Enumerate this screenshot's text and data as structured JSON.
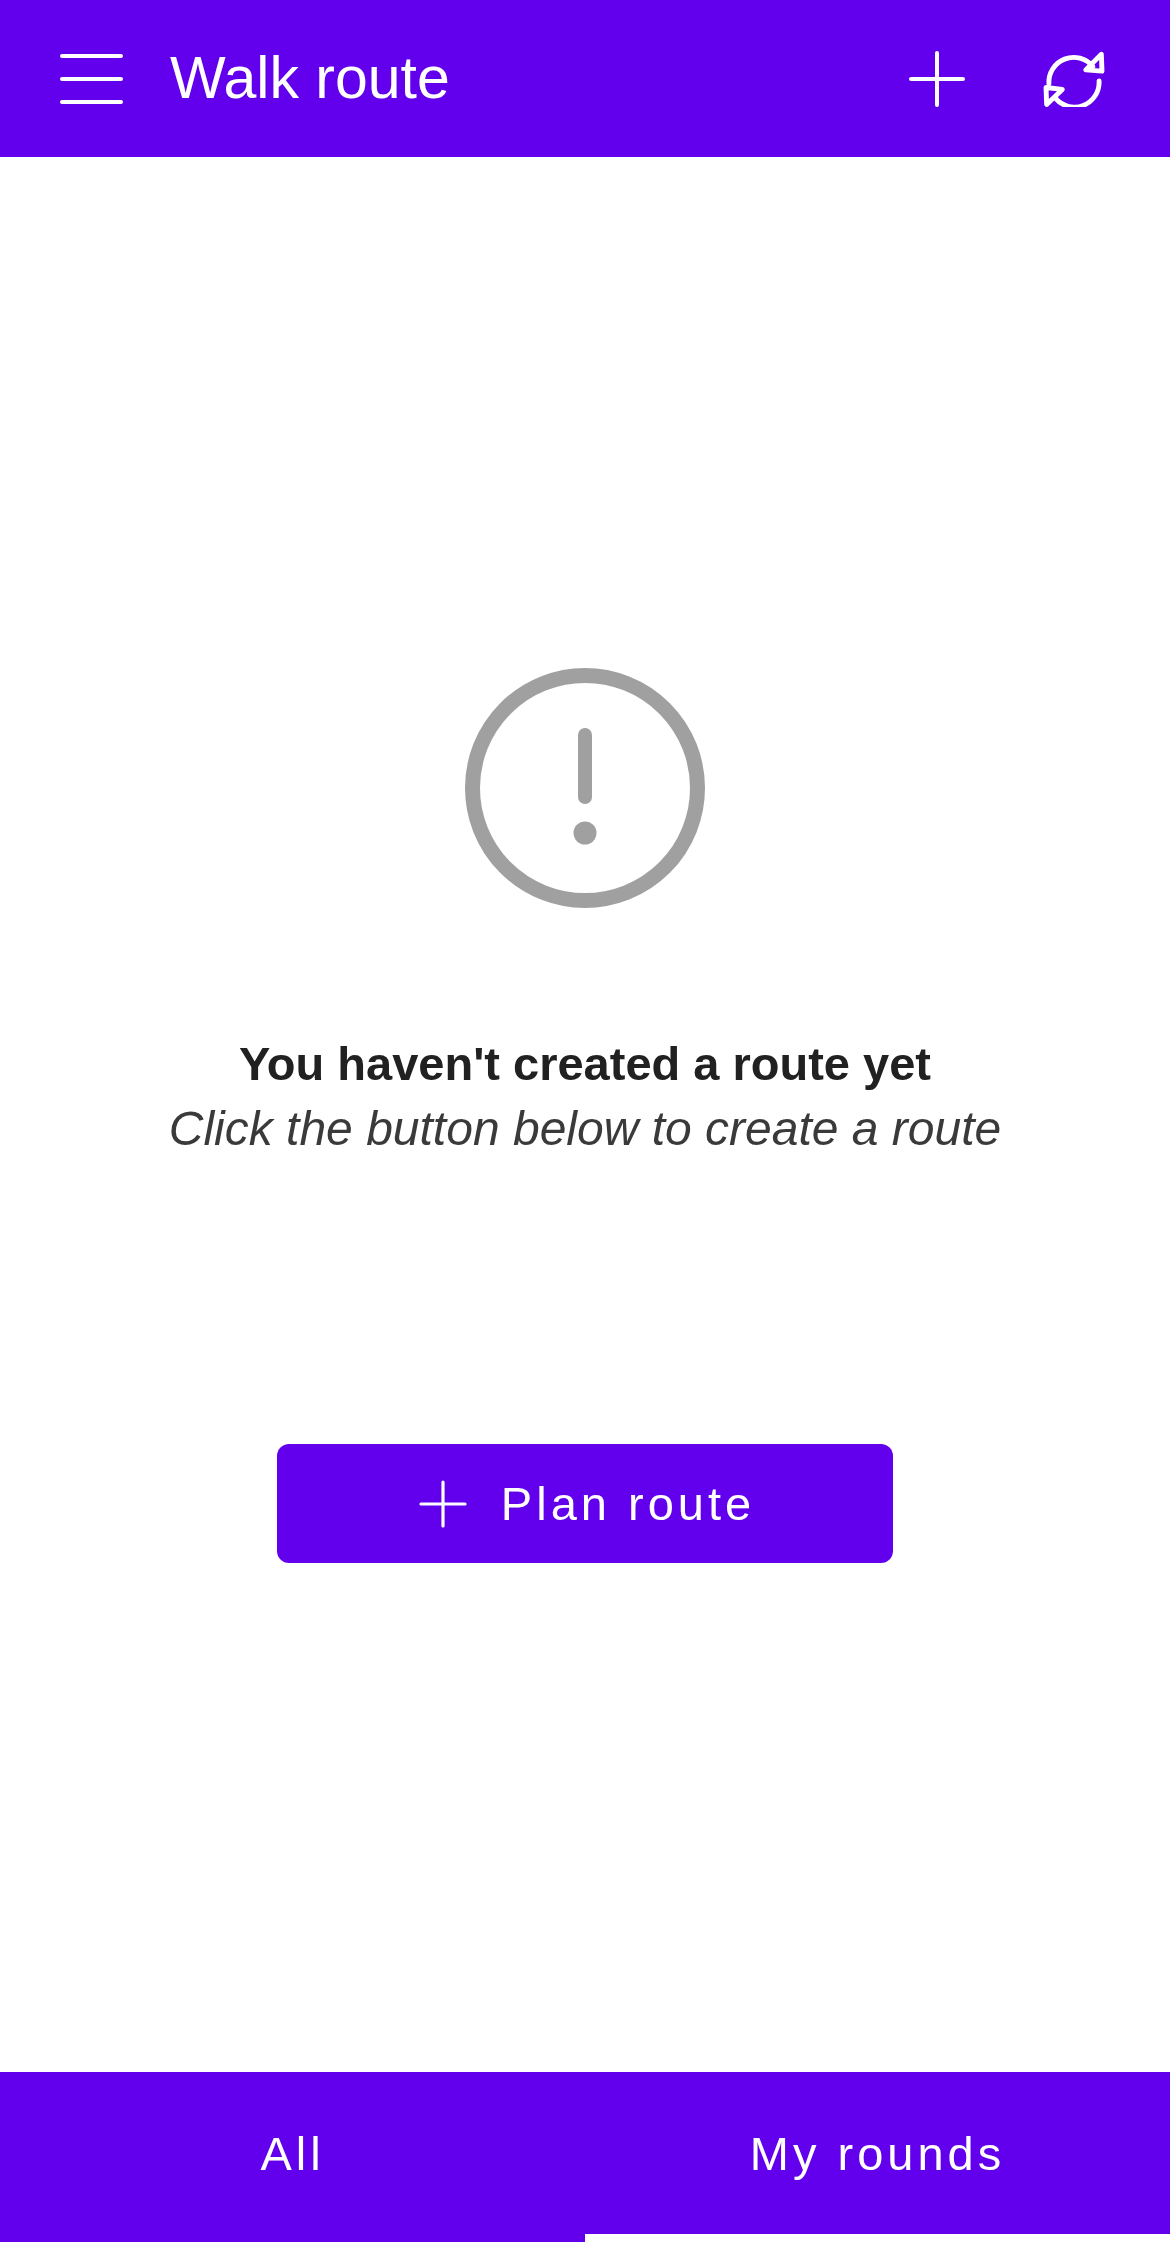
{
  "app_bar": {
    "title": "Walk route"
  },
  "empty_state": {
    "heading": "You haven't created a route yet",
    "message": "Click the button below to create a route",
    "button": {
      "label": "Plan route"
    }
  },
  "tabs": [
    {
      "label": "All",
      "selected": false
    },
    {
      "label": "My rounds",
      "selected": true
    }
  ]
}
